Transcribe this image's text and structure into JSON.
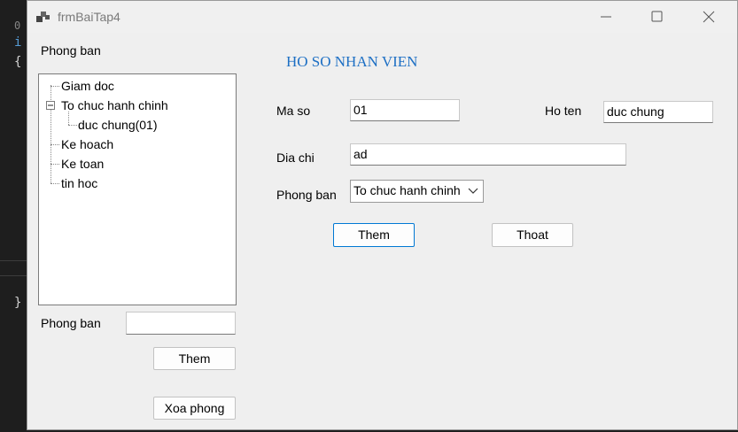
{
  "editor": {
    "line_num": "0",
    "code_1": "i",
    "brace_open": "{",
    "brace_close": "}"
  },
  "window": {
    "title": "frmBaiTap4"
  },
  "left": {
    "group_label": "Phong ban",
    "tree": [
      {
        "label": "Giam doc",
        "children": []
      },
      {
        "label": "To chuc hanh chinh",
        "expanded": true,
        "children": [
          "duc chung(01)"
        ]
      },
      {
        "label": "Ke hoach",
        "children": []
      },
      {
        "label": "Ke toan",
        "children": []
      },
      {
        "label": "tin hoc",
        "children": []
      }
    ],
    "phongban_label": "Phong ban",
    "phongban_value": "",
    "add_button": "Them",
    "delete_button": "Xoa phong"
  },
  "form": {
    "heading": "HO SO NHAN VIEN",
    "maso_label": "Ma so",
    "maso_value": "01",
    "hoten_label": "Ho ten",
    "hoten_value": "duc chung",
    "diachi_label": "Dia chi",
    "diachi_value": "ad",
    "phongban_label": "Phong ban",
    "phongban_selected": "To chuc hanh chinh",
    "add_button": "Them",
    "exit_button": "Thoat"
  }
}
